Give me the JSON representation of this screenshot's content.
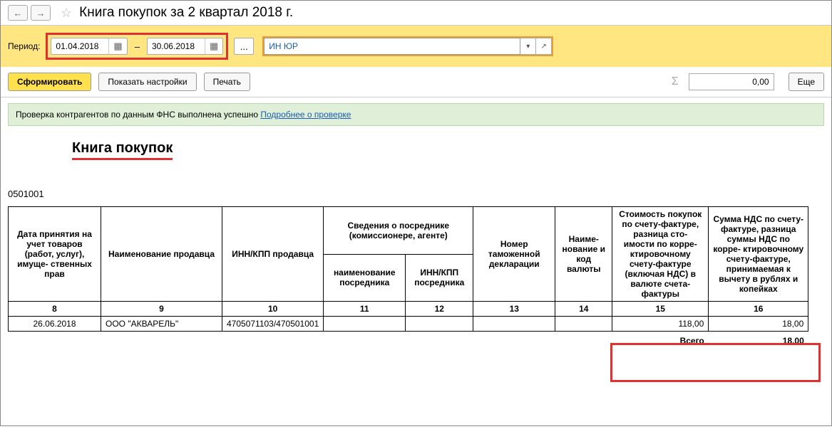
{
  "header": {
    "title": "Книга покупок за 2 квартал 2018 г."
  },
  "period": {
    "label": "Период:",
    "date_from": "01.04.2018",
    "date_to": "30.06.2018",
    "dash": "–",
    "ellipsis": "...",
    "org_value": "ИН ЮР"
  },
  "actions": {
    "generate": "Сформировать",
    "show_settings": "Показать настройки",
    "print": "Печать",
    "sum_value": "0,00",
    "more": "Еще"
  },
  "info": {
    "text": "Проверка контрагентов по данным ФНС выполнена успешно ",
    "link": "Подробнее о проверке"
  },
  "report": {
    "title": "Книга покупок",
    "code": "0501001",
    "columns": {
      "c8": "Дата принятия на учет товаров (работ, услуг), имуще- ственных прав",
      "c9": "Наименование продавца",
      "c10": "ИНН/КПП продавца",
      "c11_12": "Сведения о посреднике (комиссионере, агенте)",
      "c11": "наименование посредника",
      "c12": "ИНН/КПП посредника",
      "c13": "Номер таможенной декларации",
      "c14": "Наиме- нование и код валюты",
      "c15": "Стоимость покупок по счету-фактуре, разница сто- имости по корре- ктировочному счету-фактуре (включая НДС) в валюте счета-фактуры",
      "c16": "Сумма НДС по счету-фактуре, разница суммы НДС по корре- ктировочному счету-фактуре, принимаемая к вычету в рублях и копейках"
    },
    "col_nums": {
      "n8": "8",
      "n9": "9",
      "n10": "10",
      "n11": "11",
      "n12": "12",
      "n13": "13",
      "n14": "14",
      "n15": "15",
      "n16": "16"
    },
    "row": {
      "date": "26.06.2018",
      "seller": "ООО \"АКВАРЕЛЬ\"",
      "inn": "4705071103/470501001",
      "interm_name": "",
      "interm_inn": "",
      "customs": "",
      "curr": "",
      "cost": "118,00",
      "vat": "18,00"
    },
    "total_label": "Всего",
    "total_value": "18,00"
  }
}
